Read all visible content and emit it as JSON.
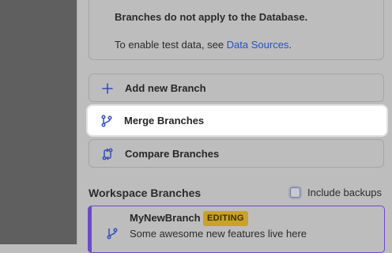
{
  "info": {
    "title": "Branches do not apply to the Database.",
    "text_prefix": "To enable test data, see ",
    "link_text": "Data Sources",
    "text_suffix": "."
  },
  "actions": [
    {
      "label": "Add new Branch",
      "icon": "plus-icon"
    },
    {
      "label": "Merge Branches",
      "icon": "merge-icon",
      "highlighted": true
    },
    {
      "label": "Compare Branches",
      "icon": "compare-icon"
    }
  ],
  "workspace": {
    "title": "Workspace Branches",
    "include_backups_label": "Include backups",
    "include_backups_checked": false,
    "branches": [
      {
        "name": "MyNewBranch",
        "badge": "EDITING",
        "description": "Some awesome new features live here",
        "icon": "branch-icon"
      }
    ]
  },
  "colors": {
    "accent": "#2f4fbf",
    "link": "#2952b8",
    "badge": "#c9a227",
    "active_border": "#6a4bc4"
  }
}
